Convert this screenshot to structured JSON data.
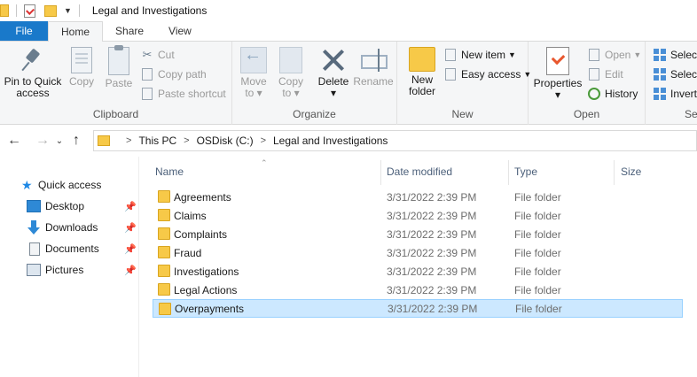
{
  "window": {
    "title": "Legal and Investigations"
  },
  "tabs": [
    {
      "label": "File"
    },
    {
      "label": "Home"
    },
    {
      "label": "Share"
    },
    {
      "label": "View"
    }
  ],
  "ribbon": {
    "clipboard": {
      "group_label": "Clipboard",
      "pin_label_1": "Pin to Quick",
      "pin_label_2": "access",
      "copy": "Copy",
      "paste": "Paste",
      "cut": "Cut",
      "copy_path": "Copy path",
      "paste_shortcut": "Paste shortcut"
    },
    "organize": {
      "group_label": "Organize",
      "move_1": "Move",
      "move_2": "to",
      "copy_1": "Copy",
      "copy_2": "to",
      "delete": "Delete",
      "rename": "Rename"
    },
    "new": {
      "group_label": "New",
      "new_folder_1": "New",
      "new_folder_2": "folder",
      "new_item": "New item",
      "easy_access": "Easy access"
    },
    "open": {
      "group_label": "Open",
      "properties": "Properties",
      "open": "Open",
      "edit": "Edit",
      "history": "History"
    },
    "select": {
      "group_label": "Sel",
      "select_all": "Select",
      "select_none": "Select",
      "invert": "Invert"
    }
  },
  "address": {
    "crumbs": [
      "This PC",
      "OSDisk (C:)",
      "Legal and Investigations"
    ]
  },
  "nav": {
    "quick_access": "Quick access",
    "items": [
      {
        "label": "Desktop"
      },
      {
        "label": "Downloads"
      },
      {
        "label": "Documents"
      },
      {
        "label": "Pictures"
      }
    ]
  },
  "columns": {
    "name": "Name",
    "date": "Date modified",
    "type": "Type",
    "size": "Size"
  },
  "files": [
    {
      "name": "Agreements",
      "date": "3/31/2022 2:39 PM",
      "type": "File folder"
    },
    {
      "name": "Claims",
      "date": "3/31/2022 2:39 PM",
      "type": "File folder"
    },
    {
      "name": "Complaints",
      "date": "3/31/2022 2:39 PM",
      "type": "File folder"
    },
    {
      "name": "Fraud",
      "date": "3/31/2022 2:39 PM",
      "type": "File folder"
    },
    {
      "name": "Investigations",
      "date": "3/31/2022 2:39 PM",
      "type": "File folder"
    },
    {
      "name": "Legal Actions",
      "date": "3/31/2022 2:39 PM",
      "type": "File folder"
    },
    {
      "name": "Overpayments",
      "date": "3/31/2022 2:39 PM",
      "type": "File folder"
    }
  ],
  "colors": {
    "file_tab": "#1979ca",
    "selection": "#cce8ff",
    "folder": "#f7c948"
  },
  "selected_index": 6
}
